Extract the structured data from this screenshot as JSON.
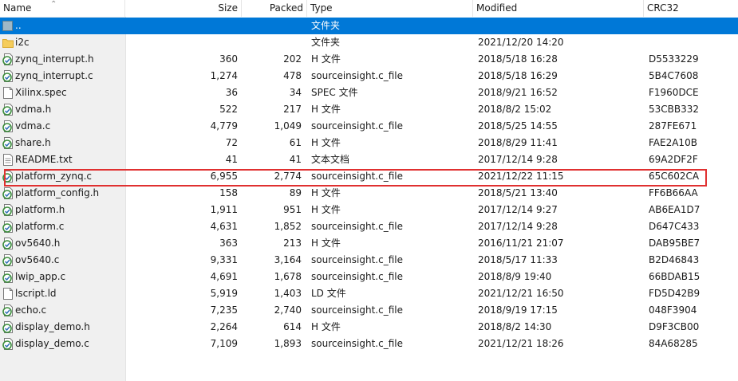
{
  "columns": {
    "name": "Name",
    "size": "Size",
    "packed": "Packed",
    "type": "Type",
    "modified": "Modified",
    "crc": "CRC32"
  },
  "rows": [
    {
      "name": "..",
      "size": "",
      "packed": "",
      "type": "文件夹",
      "modified": "",
      "crc": "",
      "icon": "parent-folder-icon",
      "selected": true
    },
    {
      "name": "i2c",
      "size": "",
      "packed": "",
      "type": "文件夹",
      "modified": "2021/12/20 14:20",
      "crc": "",
      "icon": "folder-icon"
    },
    {
      "name": "zynq_interrupt.h",
      "size": "360",
      "packed": "202",
      "type": "H 文件",
      "modified": "2018/5/18 16:28",
      "crc": "D5533229",
      "icon": "source-file-icon"
    },
    {
      "name": "zynq_interrupt.c",
      "size": "1,274",
      "packed": "478",
      "type": "sourceinsight.c_file",
      "modified": "2018/5/18 16:29",
      "crc": "5B4C7608",
      "icon": "source-file-icon"
    },
    {
      "name": "Xilinx.spec",
      "size": "36",
      "packed": "34",
      "type": "SPEC 文件",
      "modified": "2018/9/21 16:52",
      "crc": "F1960DCE",
      "icon": "blank-file-icon"
    },
    {
      "name": "vdma.h",
      "size": "522",
      "packed": "217",
      "type": "H 文件",
      "modified": "2018/8/2 15:02",
      "crc": "53CBB332",
      "icon": "source-file-icon"
    },
    {
      "name": "vdma.c",
      "size": "4,779",
      "packed": "1,049",
      "type": "sourceinsight.c_file",
      "modified": "2018/5/25 14:55",
      "crc": "287FE671",
      "icon": "source-file-icon"
    },
    {
      "name": "share.h",
      "size": "72",
      "packed": "61",
      "type": "H 文件",
      "modified": "2018/8/29 11:41",
      "crc": "FAE2A10B",
      "icon": "source-file-icon"
    },
    {
      "name": "README.txt",
      "size": "41",
      "packed": "41",
      "type": "文本文档",
      "modified": "2017/12/14 9:28",
      "crc": "69A2DF2F",
      "icon": "text-file-icon"
    },
    {
      "name": "platform_zynq.c",
      "size": "6,955",
      "packed": "2,774",
      "type": "sourceinsight.c_file",
      "modified": "2021/12/22 11:15",
      "crc": "65C602CA",
      "icon": "source-file-icon"
    },
    {
      "name": "platform_config.h",
      "size": "158",
      "packed": "89",
      "type": "H 文件",
      "modified": "2018/5/21 13:40",
      "crc": "FF6B66AA",
      "icon": "source-file-icon"
    },
    {
      "name": "platform.h",
      "size": "1,911",
      "packed": "951",
      "type": "H 文件",
      "modified": "2017/12/14 9:27",
      "crc": "AB6EA1D7",
      "icon": "source-file-icon"
    },
    {
      "name": "platform.c",
      "size": "4,631",
      "packed": "1,852",
      "type": "sourceinsight.c_file",
      "modified": "2017/12/14 9:28",
      "crc": "D647C433",
      "icon": "source-file-icon"
    },
    {
      "name": "ov5640.h",
      "size": "363",
      "packed": "213",
      "type": "H 文件",
      "modified": "2016/11/21 21:07",
      "crc": "DAB95BE7",
      "icon": "source-file-icon"
    },
    {
      "name": "ov5640.c",
      "size": "9,331",
      "packed": "3,164",
      "type": "sourceinsight.c_file",
      "modified": "2018/5/17 11:33",
      "crc": "B2D46843",
      "icon": "source-file-icon"
    },
    {
      "name": "lwip_app.c",
      "size": "4,691",
      "packed": "1,678",
      "type": "sourceinsight.c_file",
      "modified": "2018/8/9 19:40",
      "crc": "66BDAB15",
      "icon": "source-file-icon"
    },
    {
      "name": "lscript.ld",
      "size": "5,919",
      "packed": "1,403",
      "type": "LD 文件",
      "modified": "2021/12/21 16:50",
      "crc": "FD5D42B9",
      "icon": "blank-file-icon"
    },
    {
      "name": "echo.c",
      "size": "7,235",
      "packed": "2,740",
      "type": "sourceinsight.c_file",
      "modified": "2018/9/19 17:15",
      "crc": "048F3904",
      "icon": "source-file-icon"
    },
    {
      "name": "display_demo.h",
      "size": "2,264",
      "packed": "614",
      "type": "H 文件",
      "modified": "2018/8/2 14:30",
      "crc": "D9F3CB00",
      "icon": "source-file-icon"
    },
    {
      "name": "display_demo.c",
      "size": "7,109",
      "packed": "1,893",
      "type": "sourceinsight.c_file",
      "modified": "2021/12/21 18:26",
      "crc": "84A68285",
      "icon": "source-file-icon"
    }
  ],
  "colors": {
    "selection": "#0078d7",
    "highlight_box": "#e03030"
  }
}
